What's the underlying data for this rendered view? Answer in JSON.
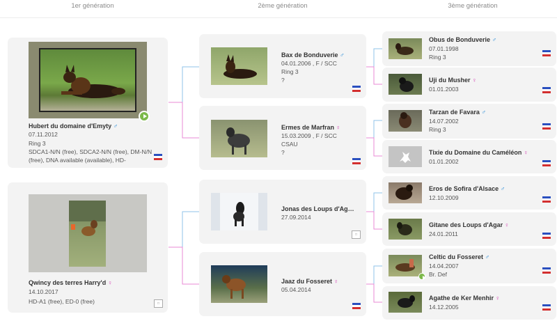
{
  "generations": [
    "1er génération",
    "2ème génération",
    "3ème génération"
  ],
  "gen1": [
    {
      "name": "Hubert du domaine d'Emyty",
      "sex": "♂",
      "date": "07.11.2012",
      "extra": "Ring 3",
      "health": "SDCA1-N/N (free), SDCA2-N/N (free), DM-N/N (free), DNA available (available), HD-"
    },
    {
      "name": "Qwincy des terres Harry'd",
      "sex": "♀",
      "date": "14.10.2017",
      "health": "HD-A1 (free), ED-0 (free)"
    }
  ],
  "gen2": [
    {
      "name": "Bax de Bonduverie",
      "sex": "♂",
      "date": "04.01.2006 , F / SCC",
      "extra": "Ring 3",
      "extra2": "?"
    },
    {
      "name": "Ermes de Marfran",
      "sex": "♀",
      "date": "15.03.2009 , F / SCC",
      "extra": "CSAU",
      "extra2": "?"
    },
    {
      "name": "Jonas des Loups d'Agar...",
      "sex": "",
      "date": "27.09.2014"
    },
    {
      "name": "Jaaz du Fosseret",
      "sex": "♀",
      "date": "05.04.2014"
    }
  ],
  "gen3": [
    {
      "name": "Obus de Bonduverie",
      "sex": "♂",
      "date": "07.01.1998",
      "extra": "Ring 3"
    },
    {
      "name": "Uji du Musher",
      "sex": "♀",
      "date": "01.01.2003"
    },
    {
      "name": "Tarzan de Favara",
      "sex": "♂",
      "date": "14.07.2002",
      "extra": "Ring 3"
    },
    {
      "name": "Tixie du Domaine du Caméléon",
      "sex": "♀",
      "date": "01.01.2002"
    },
    {
      "name": "Eros de Sofira d'Alsace",
      "sex": "♂",
      "date": "12.10.2009"
    },
    {
      "name": "Gitane des Loups d'Agar",
      "sex": "♀",
      "date": "24.01.2011"
    },
    {
      "name": "Celtic du Fosseret",
      "sex": "♂",
      "date": "14.04.2007",
      "extra": "Br. Def"
    },
    {
      "name": "Agathe de Ker Menhir",
      "sex": "♀",
      "date": "14.12.2005"
    }
  ],
  "colors": {
    "male": "#2f8fd8",
    "female": "#d43fb4",
    "card_bg": "#f3f3f3"
  }
}
